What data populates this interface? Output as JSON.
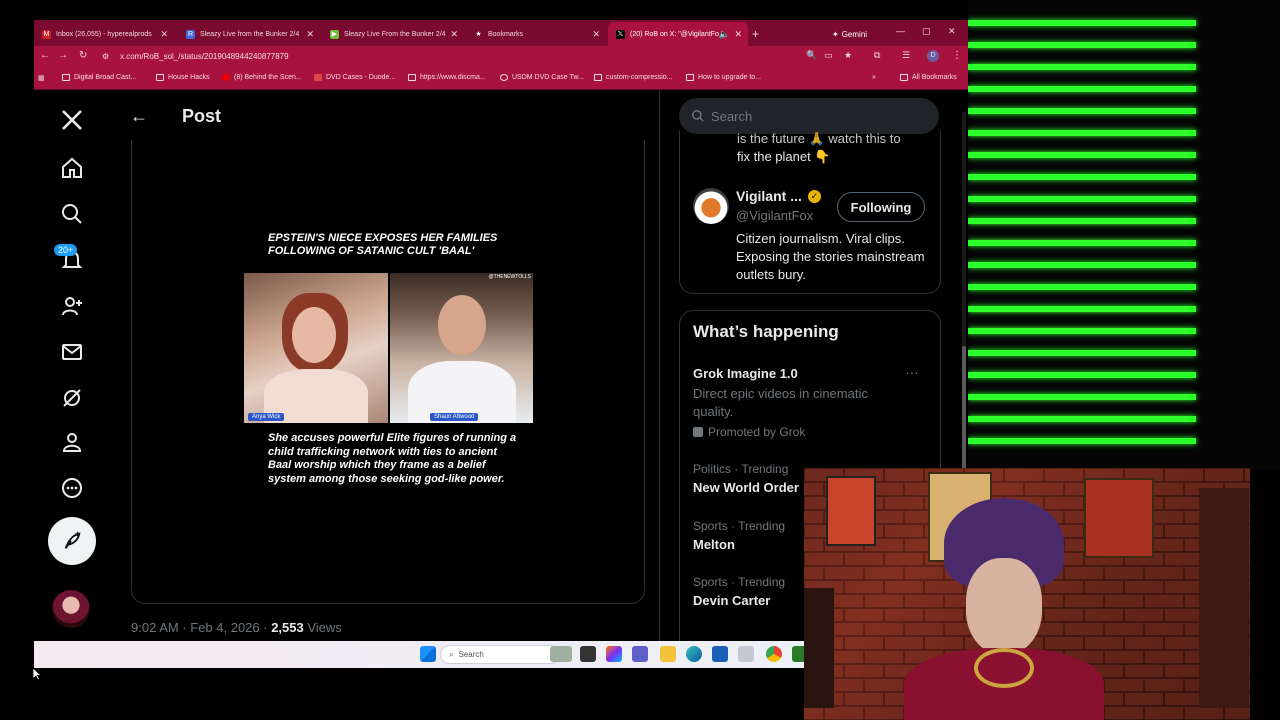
{
  "browser": {
    "tabs": [
      {
        "label": "Inbox (26,055) - hyperealprods",
        "icon": "gmail-icon",
        "active": false
      },
      {
        "label": "Sleazy Live from the Bunker 2/4",
        "icon": "restream-icon",
        "active": false
      },
      {
        "label": "Sleazy Live From the Bunker 2/4",
        "icon": "rumble-icon",
        "active": false
      },
      {
        "label": "Bookmarks",
        "icon": "star-icon",
        "active": false
      },
      {
        "label": "(20) RoB on X: \"@VigilantFo",
        "icon": "x-icon",
        "active": true
      }
    ],
    "gemini_label": "Gemini",
    "url": "x.com/RoB_sol_/status/2019048944240877879",
    "bookmarks": [
      "Digital Broad Cast...",
      "House Hacks",
      "(8) Behind the Scen...",
      "DVD Cases - Duode...",
      "https://www.discma...",
      "USDM DVD Case Tw...",
      "custom-compressio...",
      "How to upgrade to..."
    ],
    "all_bookmarks": "All Bookmarks"
  },
  "x_nav": {
    "notif_badge": "20+"
  },
  "post": {
    "header_title": "Post",
    "headline": "EPSTEIN'S NIECE EXPOSES HER FAMILIES FOLLOWING OF SATANIC CULT 'BAAL'",
    "watermark": "@THENEWTOLLS",
    "left_name": "Anya Wick",
    "right_name": "Shaun Attwood",
    "caption": "She accuses powerful Elite figures of running a child trafficking network with ties to ancient Baal worship which they frame as a belief system among those seeking god-like power.",
    "time": "9:02 AM · Feb 4, 2026 · ",
    "views_count": "2,553",
    "views_label": " Views"
  },
  "sidebar": {
    "search_placeholder": "Search",
    "partial_text_1": "is the future 🙏   watch this to",
    "partial_text_2": "fix the planet 👇",
    "account_name": "Vigilant ...",
    "account_handle": "@VigilantFox",
    "follow_label": "Following",
    "account_bio": "Citizen journalism. Viral clips. Exposing the stories mainstream outlets bury.",
    "happening_title": "What’s happening",
    "trends": [
      {
        "context": "",
        "title": "Grok Imagine 1.0",
        "desc": "Direct epic videos in cinematic quality.",
        "promo": "Promoted by Grok"
      },
      {
        "context": "Politics · Trending",
        "title": "New World Order"
      },
      {
        "context": "Sports · Trending",
        "title": "Melton"
      },
      {
        "context": "Sports · Trending",
        "title": "Devin Carter"
      }
    ]
  },
  "taskbar": {
    "search_label": "Search"
  },
  "colors": {
    "accent": "#1d9bf0",
    "browser_chrome": "#a8123f",
    "neon": "#2dff2d"
  }
}
